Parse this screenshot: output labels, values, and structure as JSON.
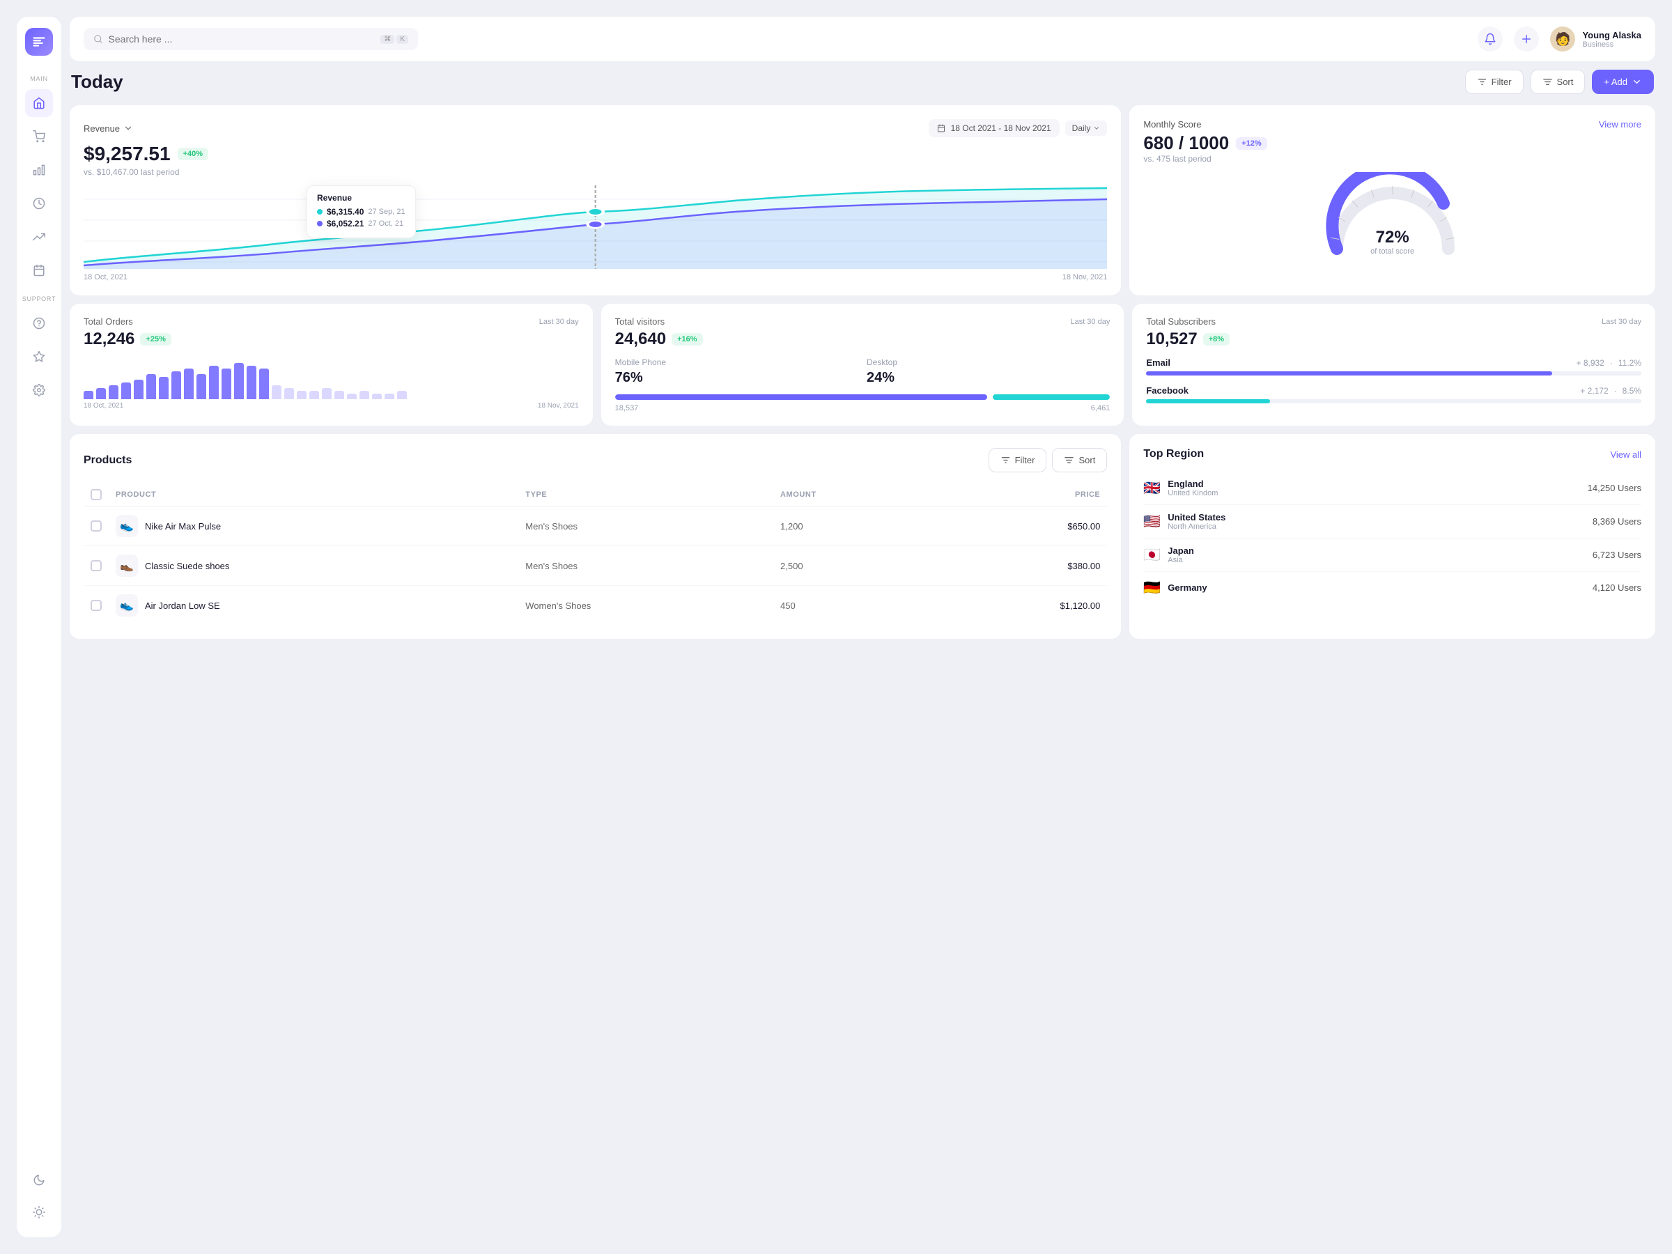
{
  "app": {
    "logo_label": "App Logo"
  },
  "sidebar": {
    "main_label": "MAIN",
    "support_label": "SUPPORT",
    "items_main": [
      {
        "name": "home",
        "icon": "home",
        "active": true
      },
      {
        "name": "cart",
        "icon": "cart",
        "active": false
      },
      {
        "name": "chart-bar",
        "icon": "chart-bar",
        "active": false
      },
      {
        "name": "clock",
        "icon": "clock",
        "active": false
      },
      {
        "name": "trend",
        "icon": "trend",
        "active": false
      },
      {
        "name": "calendar",
        "icon": "calendar",
        "active": false
      }
    ],
    "items_support": [
      {
        "name": "help",
        "icon": "help",
        "active": false
      },
      {
        "name": "magic",
        "icon": "magic",
        "active": false
      },
      {
        "name": "settings",
        "icon": "settings",
        "active": false
      }
    ],
    "bottom": [
      {
        "name": "moon",
        "icon": "moon"
      },
      {
        "name": "sun",
        "icon": "sun"
      }
    ]
  },
  "topbar": {
    "search_placeholder": "Search here ...",
    "shortcut_cmd": "⌘",
    "shortcut_key": "K",
    "user_name": "Young Alaska",
    "user_role": "Business"
  },
  "page": {
    "title": "Today",
    "filter_label": "Filter",
    "sort_label": "Sort",
    "add_label": "+ Add"
  },
  "revenue": {
    "label": "Revenue",
    "date_range": "18 Oct 2021 - 18 Nov 2021",
    "period": "Daily",
    "value": "$9,257.51",
    "badge": "+40%",
    "vs_text": "vs. $10,467.00 last period",
    "tooltip": {
      "title": "Revenue",
      "line1_color": "#22d4d4",
      "line1_label": "$6,315.40",
      "line1_date": "27 Sep, 21",
      "line2_color": "#6c63ff",
      "line2_label": "$6,052.21",
      "line2_date": "27 Oct, 21"
    },
    "date_start": "18 Oct, 2021",
    "date_end": "18 Nov, 2021"
  },
  "monthly_score": {
    "label": "Monthly Score",
    "view_more": "View more",
    "value": "680 / 1000",
    "badge": "+12%",
    "vs_text": "vs. 475 last period",
    "percent": "72%",
    "sub": "of total score"
  },
  "total_orders": {
    "label": "Total Orders",
    "period": "Last 30 day",
    "value": "12,246",
    "badge": "+25%",
    "date_start": "18 Oct, 2021",
    "date_end": "18 Nov, 2021",
    "bars": [
      3,
      4,
      5,
      6,
      7,
      9,
      8,
      10,
      11,
      9,
      12,
      11,
      13,
      12,
      11,
      5,
      4,
      3,
      3,
      4,
      3,
      2,
      3,
      2,
      2,
      3
    ]
  },
  "total_visitors": {
    "label": "Total visitors",
    "period": "Last 30 day",
    "value": "24,640",
    "badge": "+16%",
    "mobile_label": "Mobile Phone",
    "mobile_pct": "76%",
    "desktop_label": "Desktop",
    "desktop_pct": "24%",
    "mobile_count": "18,537",
    "desktop_count": "6,461"
  },
  "total_subscribers": {
    "label": "Total Subscribers",
    "period": "Last 30 day",
    "value": "10,527",
    "badge": "+8%",
    "email_label": "Email",
    "email_count": "+ 8,932",
    "email_pct": "11.2%",
    "facebook_label": "Facebook",
    "facebook_count": "+ 2,172",
    "facebook_pct": "8.5%"
  },
  "products": {
    "title": "Products",
    "filter_label": "Filter",
    "sort_label": "Sort",
    "columns": [
      "PRODUCT",
      "TYPE",
      "AMOUNT",
      "PRICE"
    ],
    "rows": [
      {
        "name": "Nike Air Max Pulse",
        "type": "Men's Shoes",
        "amount": "1,200",
        "price": "$650.00",
        "emoji": "👟"
      },
      {
        "name": "Classic Suede shoes",
        "type": "Men's Shoes",
        "amount": "2,500",
        "price": "$380.00",
        "emoji": "👞"
      },
      {
        "name": "Air Jordan Low SE",
        "type": "Women's Shoes",
        "amount": "450",
        "price": "$1,120.00",
        "emoji": "👟"
      }
    ]
  },
  "top_region": {
    "title": "Top Region",
    "view_all": "View all",
    "regions": [
      {
        "flag": "🇬🇧",
        "name": "England",
        "sub": "United Kindom",
        "users": "14,250 Users"
      },
      {
        "flag": "🇺🇸",
        "name": "United States",
        "sub": "North America",
        "users": "8,369 Users"
      },
      {
        "flag": "🇯🇵",
        "name": "Japan",
        "sub": "Asia",
        "users": "6,723 Users"
      },
      {
        "flag": "🇩🇪",
        "name": "Germany",
        "sub": "",
        "users": "4,120 Users"
      }
    ]
  }
}
